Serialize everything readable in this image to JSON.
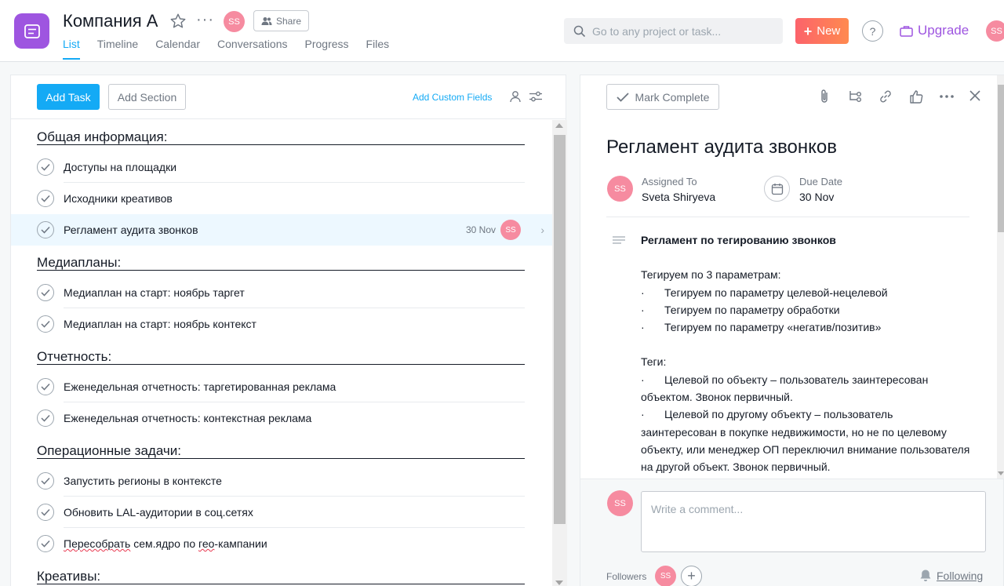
{
  "header": {
    "project_title": "Компания А",
    "avatar_initials": "SS",
    "share_label": "Share",
    "tabs": [
      {
        "label": "List"
      },
      {
        "label": "Timeline"
      },
      {
        "label": "Calendar"
      },
      {
        "label": "Conversations"
      },
      {
        "label": "Progress"
      },
      {
        "label": "Files"
      }
    ],
    "active_tab": "List",
    "search_placeholder": "Go to any project or task...",
    "new_label": "New",
    "help_label": "?",
    "upgrade_label": "Upgrade",
    "user_initials": "SS"
  },
  "toolbar": {
    "add_task_label": "Add Task",
    "add_section_label": "Add Section",
    "custom_fields_label": "Add Custom Fields"
  },
  "list": {
    "sections": [
      {
        "title": "Общая информация:",
        "tasks": [
          {
            "name": "Доступы на площадки"
          },
          {
            "name": "Исходники креативов"
          },
          {
            "name": "Регламент аудита звонков",
            "due": "30 Nov",
            "assignee": "SS",
            "selected": true
          }
        ]
      },
      {
        "title": "Медиапланы:",
        "tasks": [
          {
            "name": "Медиаплан на старт: ноябрь таргет"
          },
          {
            "name": "Медиаплан на старт: ноябрь контекст"
          }
        ]
      },
      {
        "title": "Отчетность:",
        "tasks": [
          {
            "name": "Еженедельная отчетность: таргетированная реклама"
          },
          {
            "name": "Еженедельная отчетность: контекстная реклама"
          }
        ]
      },
      {
        "title": "Операционные задачи:",
        "tasks": [
          {
            "name": "Запустить регионы в контексте"
          },
          {
            "name": "Обновить LAL-аудитории в соц.сетях"
          },
          {
            "name": "Пересобрать сем.ядро по гео-кампании",
            "spell_parts": [
              "Пересобрать",
              " сем.ядро по ",
              "гео",
              "-кампании"
            ]
          }
        ]
      },
      {
        "title": "Креативы:",
        "tasks": []
      }
    ]
  },
  "detail": {
    "mark_complete_label": "Mark Complete",
    "title": "Регламент аудита звонков",
    "assigned_to_label": "Assigned To",
    "assignee_name": "Sveta Shiryeva",
    "assignee_initials": "SS",
    "due_date_label": "Due Date",
    "due_date": "30 Nov",
    "description": {
      "heading": "Регламент по тегированию звонков",
      "intro": "Тегируем по 3 параметрам:",
      "params": [
        "Тегируем по параметру целевой-нецелевой",
        "Тегируем по параметру обработки",
        "Тегируем по параметру «негатив/позитив»"
      ],
      "tags_label": "Теги:",
      "tags": [
        "Целевой по объекту – пользователь заинтересован объектом. Звонок первичный.",
        "Целевой по другому объекту – пользователь заинтересован в покупке недвижимости, но не по целевому объекту, или менеджер ОП переключил внимание пользователя на другой объект. Звонок первичный."
      ],
      "bullet": "·"
    },
    "comment_placeholder": "Write a comment...",
    "comment_initials": "SS",
    "followers_label": "Followers",
    "follower_initials": "SS",
    "add_follower_label": "+",
    "following_label": "Following"
  },
  "colors": {
    "accent": "#14aaf5",
    "project_icon": "#9e55e0",
    "avatar": "#f68ba0",
    "upgrade": "#9e55e0",
    "new_gradient_start": "#fc636b",
    "new_gradient_end": "#ff8a4f"
  },
  "icons": {
    "project": "list-icon",
    "favorite": "star-icon",
    "more": "ellipsis-icon",
    "share": "people-icon",
    "search": "search-icon",
    "new": "plus-icon",
    "upgrade": "briefcase-icon",
    "attach": "paperclip-icon",
    "subtask": "subtask-icon",
    "link": "link-icon",
    "like": "thumbs-up-icon",
    "close": "close-icon",
    "calendar": "calendar-icon",
    "description": "text-lines-icon",
    "following": "bell-icon"
  }
}
